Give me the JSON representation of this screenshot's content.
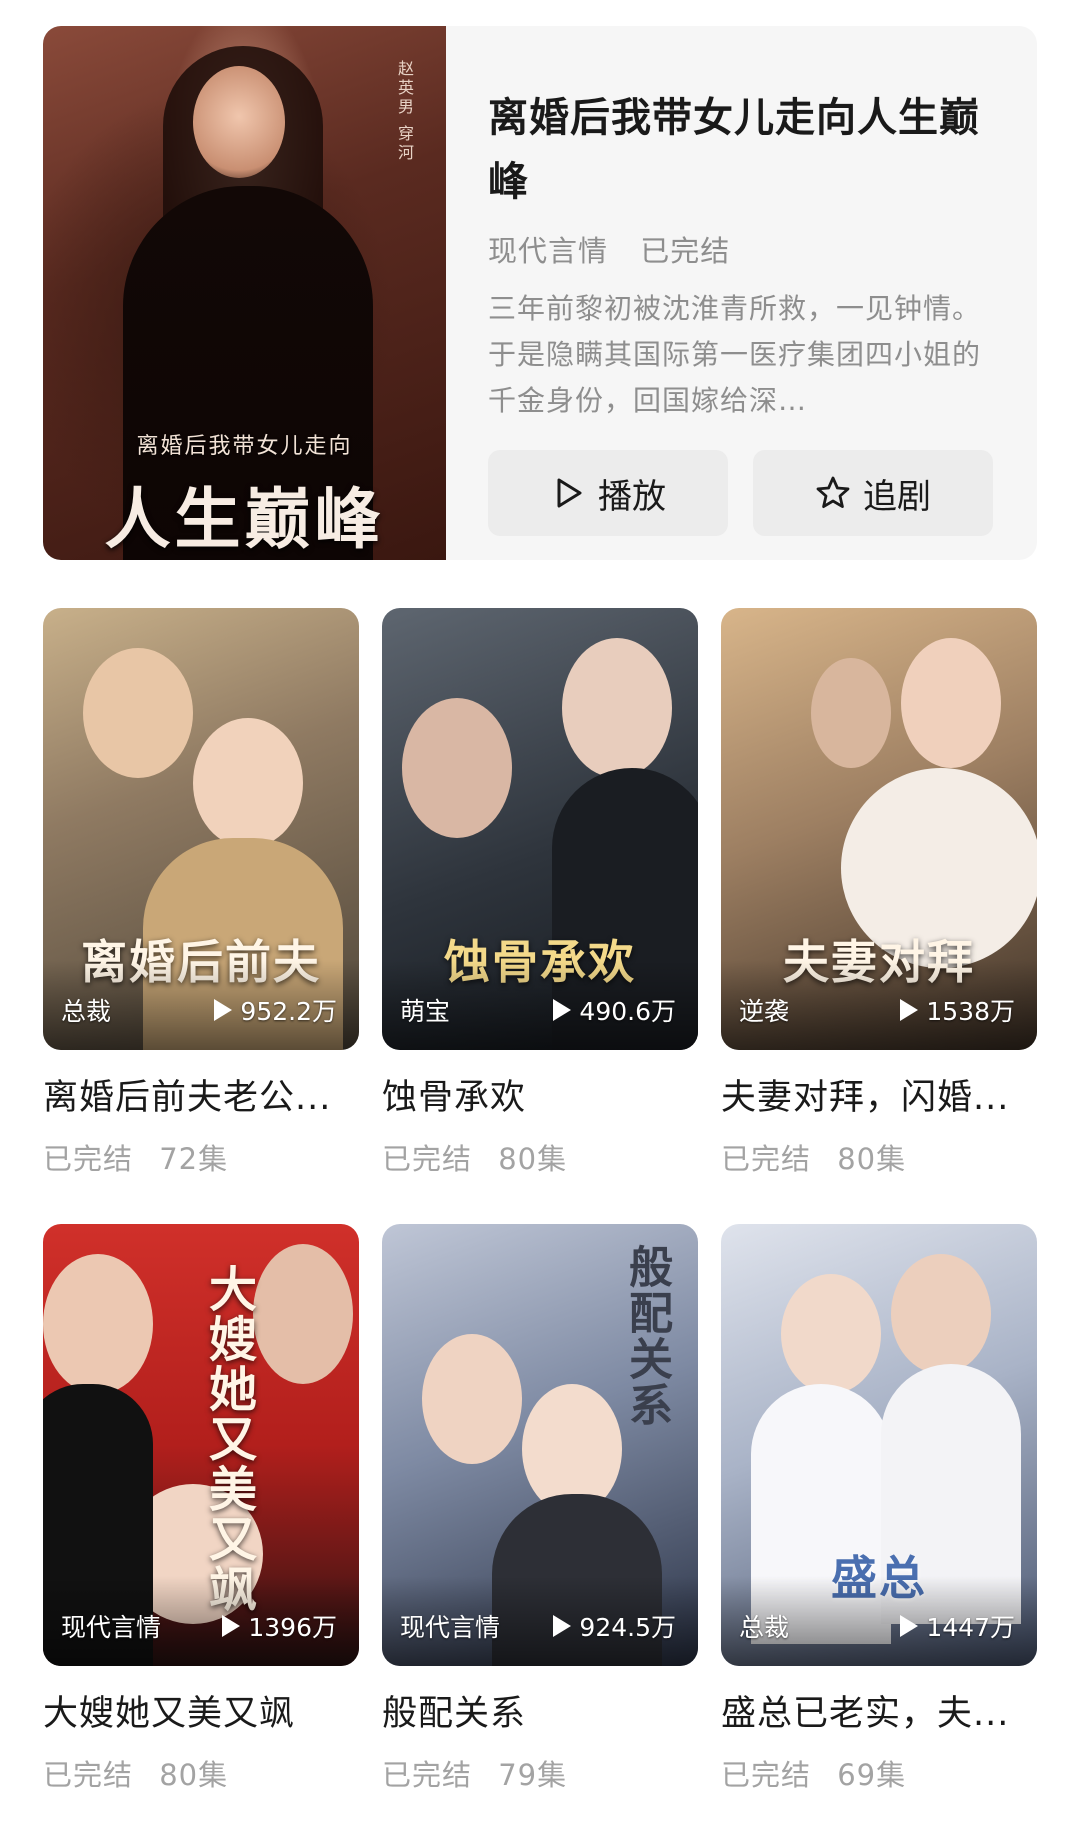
{
  "featured": {
    "poster_side_text": "赵英男 穿河",
    "poster_subtitle": "离婚后我带女儿走向",
    "poster_title": "人生巅峰",
    "title": "离婚后我带女儿走向人生巅峰",
    "tags": [
      "现代言情",
      "已完结"
    ],
    "description": "三年前黎初被沈淮青所救，一见钟情。于是隐瞒其国际第一医疗集团四小姐的千金身份，回国嫁给深…",
    "play_label": "播放",
    "follow_label": "追剧",
    "play_icon": "play-outline-icon",
    "follow_icon": "star-outline-icon"
  },
  "cards": [
    {
      "poster_title": "离婚后前夫",
      "tag": "总裁",
      "plays": "952.2万",
      "title": "离婚后前夫老公...",
      "status": "已完结",
      "episodes": "72集"
    },
    {
      "poster_title": "蚀骨承欢",
      "tag": "萌宝",
      "plays": "490.6万",
      "title": "蚀骨承欢",
      "status": "已完结",
      "episodes": "80集"
    },
    {
      "poster_title": "夫妻对拜",
      "tag": "逆袭",
      "plays": "1538万",
      "title": "夫妻对拜，闪婚...",
      "status": "已完结",
      "episodes": "80集"
    },
    {
      "poster_title": "大嫂她又美又飒",
      "tag": "现代言情",
      "plays": "1396万",
      "title": "大嫂她又美又飒",
      "status": "已完结",
      "episodes": "80集"
    },
    {
      "poster_title": "般配关系",
      "tag": "现代言情",
      "plays": "924.5万",
      "title": "般配关系",
      "status": "已完结",
      "episodes": "79集"
    },
    {
      "poster_title": "盛总",
      "tag": "总裁",
      "plays": "1447万",
      "title": "盛总已老实，夫...",
      "status": "已完结",
      "episodes": "69集"
    }
  ],
  "colors": {
    "background": "#ffffff",
    "featured_bg": "#f6f6f6",
    "button_bg": "#ececec",
    "primary_text": "#1a1a1a",
    "secondary_text": "#8e8e8e",
    "meta_text": "#a3a3a3"
  }
}
